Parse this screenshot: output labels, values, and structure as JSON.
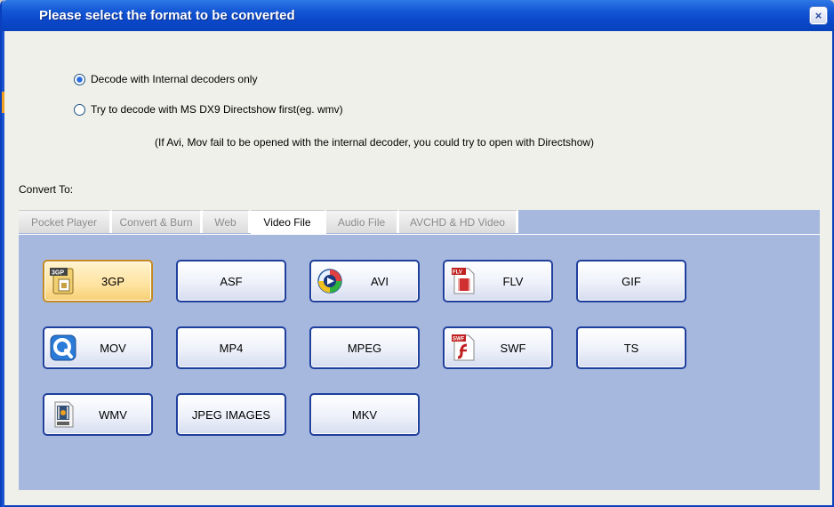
{
  "window": {
    "title": "Please select the format to be converted",
    "close_symbol": "×"
  },
  "options": {
    "decode_internal": "Decode with Internal decoders only",
    "decode_directshow": "Try to decode with MS DX9 Directshow first(eg. wmv)",
    "selected": "decode_internal",
    "note": "(If Avi, Mov fail to be opened with the internal decoder, you could try to open with Directshow)"
  },
  "convert_to_label": "Convert To:",
  "tabs": [
    {
      "label": "Pocket  Player"
    },
    {
      "label": "Convert & Burn"
    },
    {
      "label": "Web"
    },
    {
      "label": "Video  File",
      "active": true
    },
    {
      "label": "Audio  File"
    },
    {
      "label": "AVCHD & HD Video"
    }
  ],
  "formats": [
    {
      "label": "3GP",
      "icon": "3gp-file-icon",
      "selected": true
    },
    {
      "label": "ASF"
    },
    {
      "label": "AVI",
      "icon": "avi-file-icon"
    },
    {
      "label": "FLV",
      "icon": "flv-file-icon"
    },
    {
      "label": "GIF"
    },
    {
      "label": "MOV",
      "icon": "quicktime-icon"
    },
    {
      "label": "MP4"
    },
    {
      "label": "MPEG"
    },
    {
      "label": "SWF",
      "icon": "swf-flash-icon"
    },
    {
      "label": "TS"
    },
    {
      "label": "WMV",
      "icon": "wmv-file-icon"
    },
    {
      "label": "JPEG IMAGES"
    },
    {
      "label": "MKV"
    }
  ],
  "colors": {
    "titlebar": "#0a46c8",
    "panel": "#a7b8df",
    "button_border": "#1f3f9c",
    "selected_button": "#ffe3a0"
  }
}
